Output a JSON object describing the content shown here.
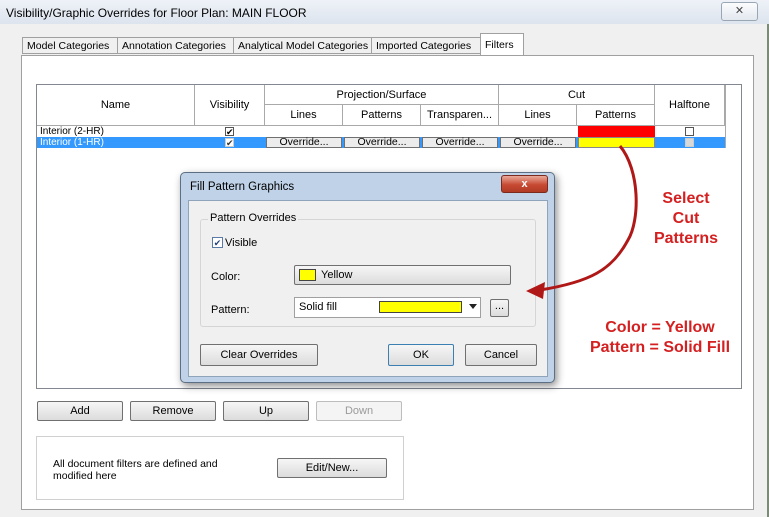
{
  "window": {
    "title": "Visibility/Graphic Overrides for Floor Plan: MAIN FLOOR",
    "close_glyph": "✕"
  },
  "tabs": [
    {
      "label": "Model Categories"
    },
    {
      "label": "Annotation Categories"
    },
    {
      "label": "Analytical Model Categories"
    },
    {
      "label": "Imported Categories"
    },
    {
      "label": "Filters"
    }
  ],
  "grid": {
    "headers": {
      "name": "Name",
      "visibility": "Visibility",
      "projection_surface": "Projection/Surface",
      "cut": "Cut",
      "halftone": "Halftone",
      "proj_lines": "Lines",
      "proj_patterns": "Patterns",
      "proj_transparency": "Transparen...",
      "cut_lines": "Lines",
      "cut_patterns": "Patterns"
    },
    "rows": [
      {
        "name": "Interior (2-HR)",
        "visible": "✔",
        "cut_pattern_color": "#ff0000",
        "selected": false
      },
      {
        "name": "Interior (1-HR)",
        "visible": "✔",
        "cut_pattern_color": "#ffff00",
        "selected": true,
        "override_label": "Override..."
      }
    ]
  },
  "buttons": {
    "add": "Add",
    "remove": "Remove",
    "up": "Up",
    "down": "Down",
    "edit_new": "Edit/New..."
  },
  "info_text": "All document filters are defined and modified here",
  "dialog": {
    "title": "Fill Pattern Graphics",
    "close_glyph": "x",
    "group_label": "Pattern Overrides",
    "visible_label": "Visible",
    "visible_check": "✔",
    "color_label": "Color:",
    "color_value": "Yellow",
    "color_swatch": "#ffff00",
    "pattern_label": "Pattern:",
    "pattern_value": "Solid fill",
    "pattern_swatch": "#ffff00",
    "browse_label": "...",
    "clear_overrides": "Clear Overrides",
    "ok": "OK",
    "cancel": "Cancel"
  },
  "annotations": {
    "select_1": "Select",
    "select_2": "Cut",
    "select_3": "Patterns",
    "result_1": "Color = Yellow",
    "result_2": "Pattern = Solid Fill"
  },
  "colors": {
    "selection": "#3399ff",
    "annotation": "#d42020",
    "arrow": "#b01818"
  }
}
